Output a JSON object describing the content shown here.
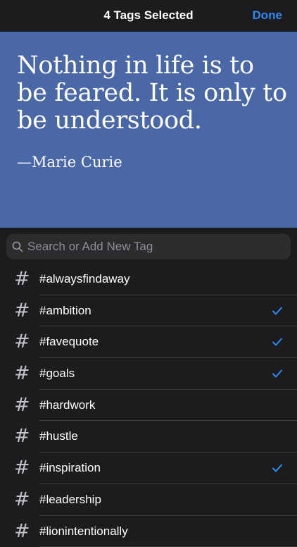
{
  "nav": {
    "title": "4 Tags Selected",
    "done_label": "Done"
  },
  "quote": {
    "text": "Nothing in life is to be feared. It is only to be understood.",
    "author": "—Marie Curie",
    "background": "#4a67a8"
  },
  "search": {
    "placeholder": "Search or Add New Tag",
    "icon": "magnifier-icon"
  },
  "tags": [
    {
      "label": "#alwaysfindaway",
      "selected": false
    },
    {
      "label": "#ambition",
      "selected": true
    },
    {
      "label": "#favequote",
      "selected": true
    },
    {
      "label": "#goals",
      "selected": true
    },
    {
      "label": "#hardwork",
      "selected": false
    },
    {
      "label": "#hustle",
      "selected": false
    },
    {
      "label": "#inspiration",
      "selected": true
    },
    {
      "label": "#leadership",
      "selected": false
    },
    {
      "label": "#lionintentionally",
      "selected": false
    }
  ],
  "colors": {
    "accent": "#2f89f5",
    "background": "#1c1c1e",
    "search_field": "#2c2c2e"
  }
}
